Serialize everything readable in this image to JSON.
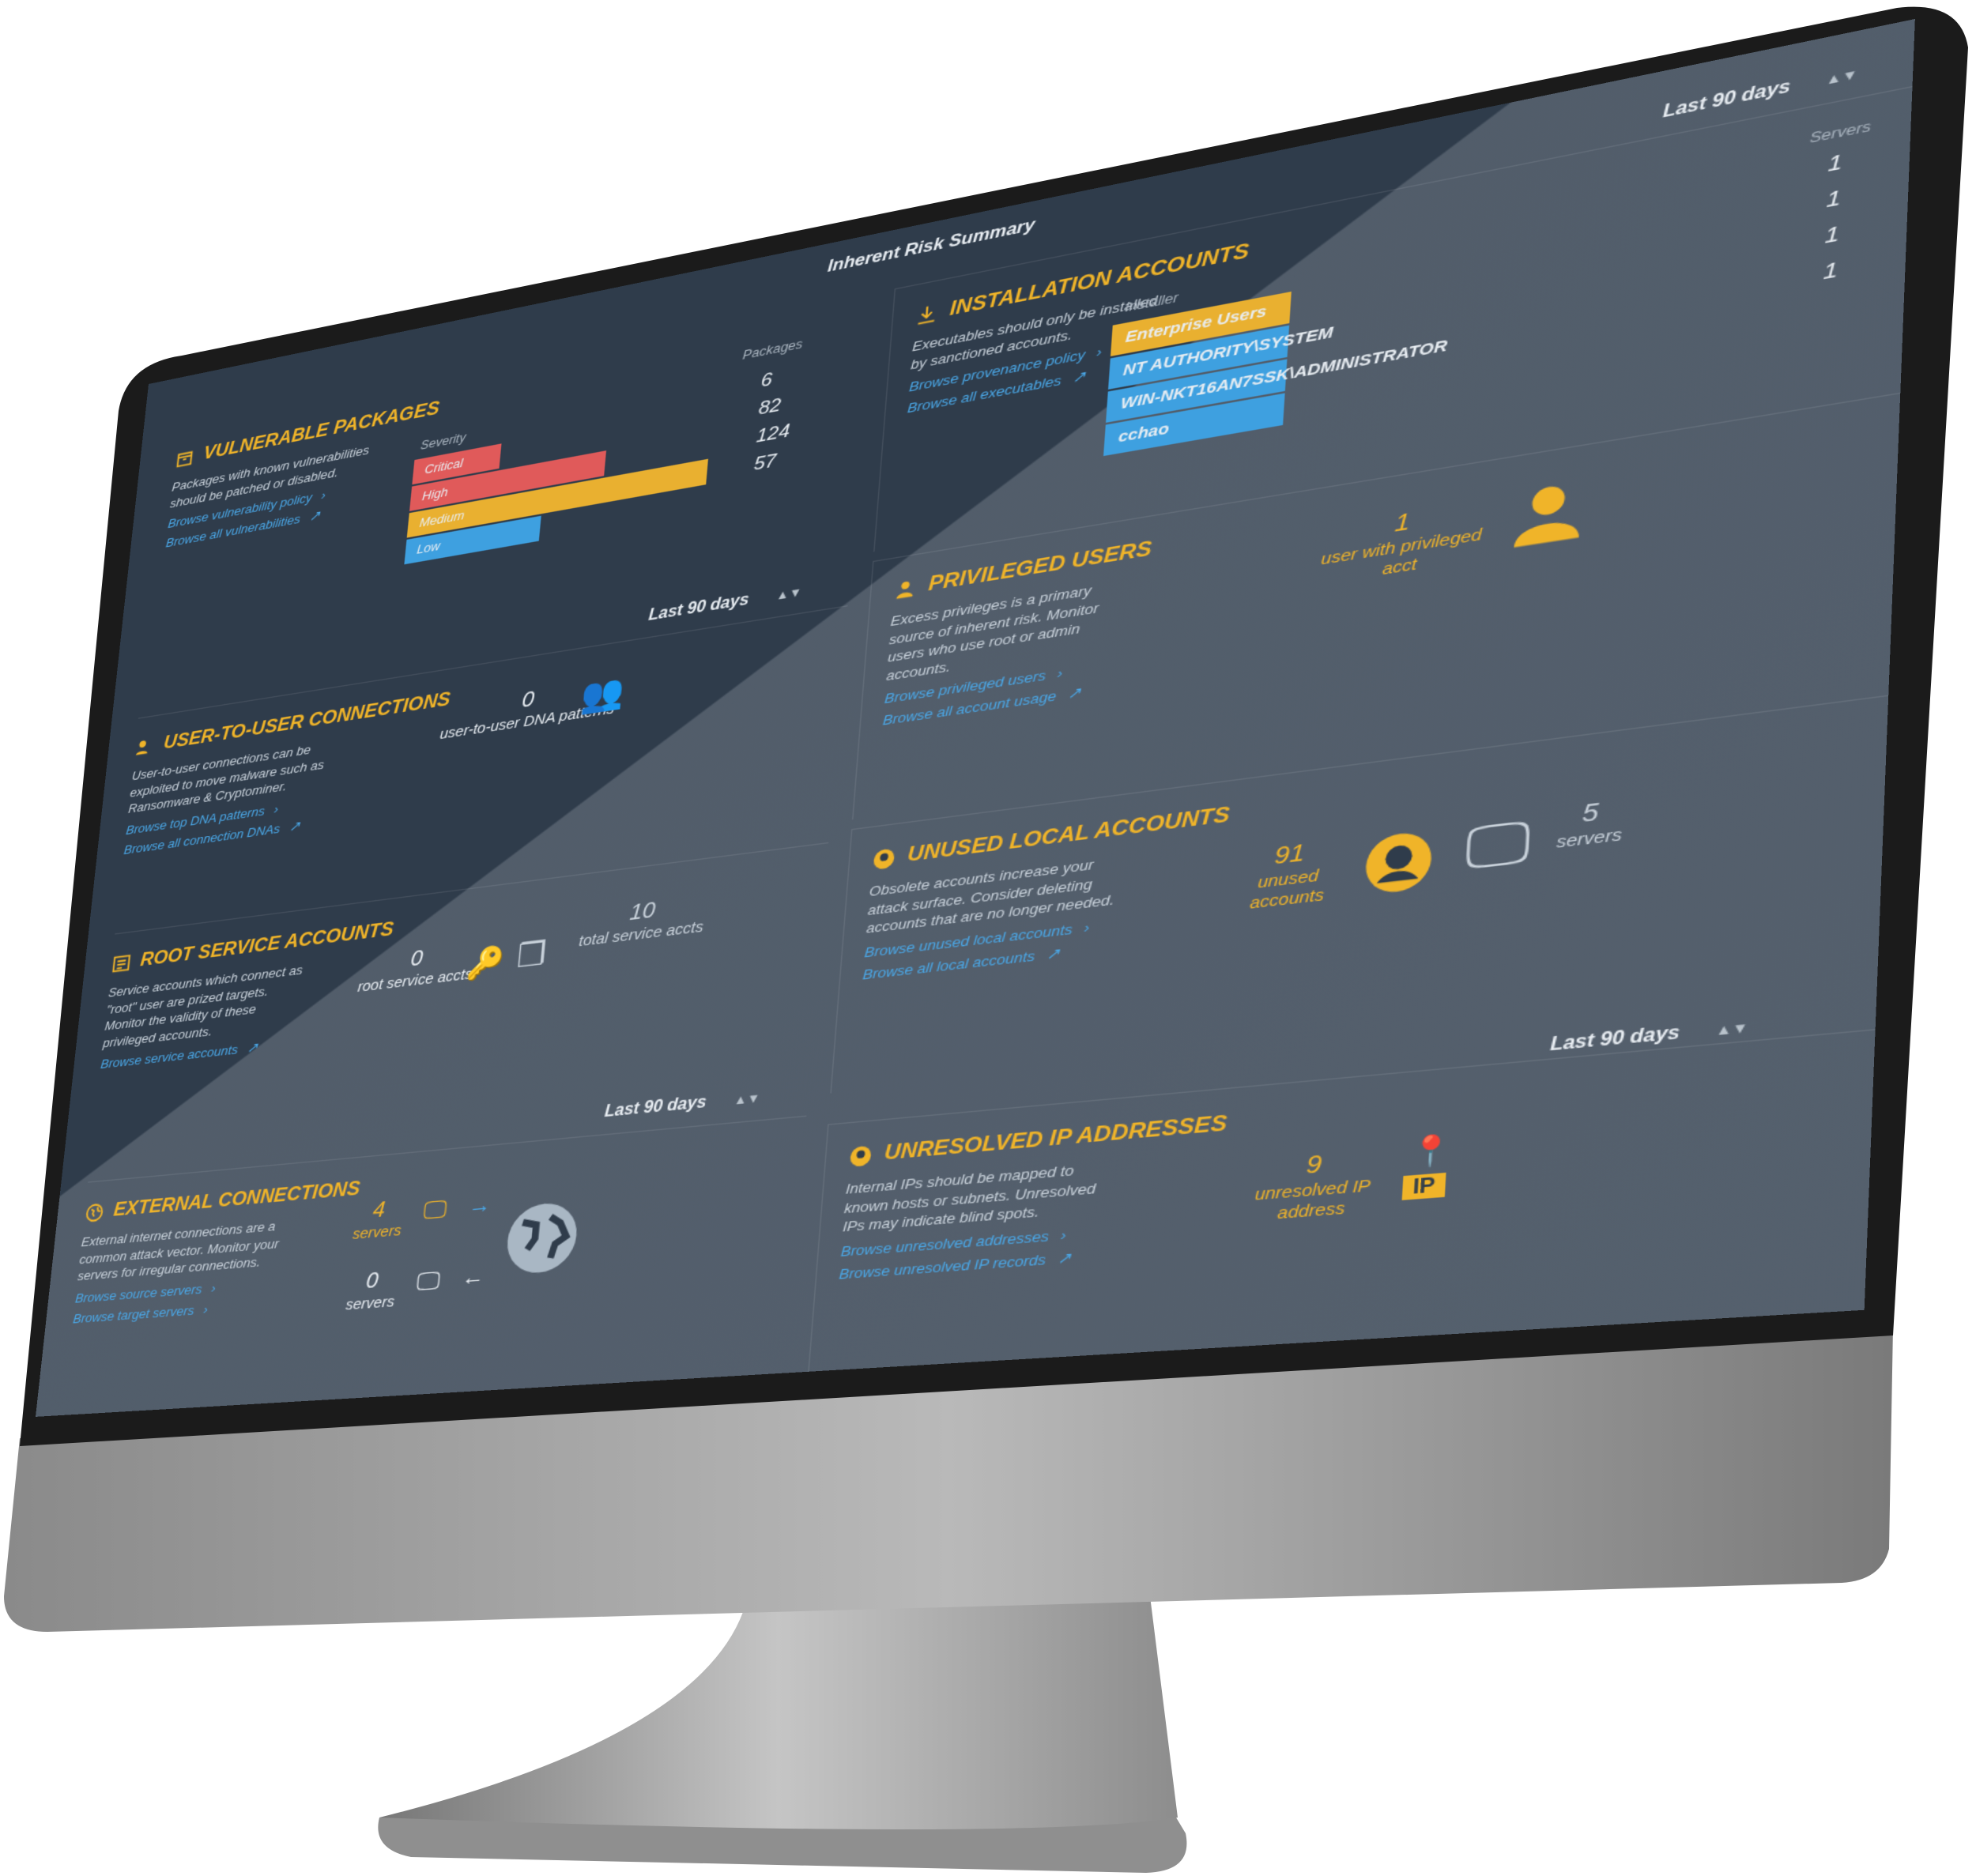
{
  "title": "Inherent Risk Summary",
  "colors": {
    "accent": "#f0b429",
    "link": "#4aa8e8",
    "critical": "#e05a5a",
    "high": "#e05a5a",
    "medium": "#e9b030",
    "low": "#3ea0e0",
    "bg_dark": "#2f3c4b"
  },
  "ranges": {
    "top": "Last 90 days",
    "mid_left": "Last 90 days",
    "bottom_left": "Last 90 days",
    "bottom_right": "Last 90 days"
  },
  "vulnerable": {
    "title": "VULNERABLE PACKAGES",
    "icon": "package-icon",
    "desc": "Packages with known vulnerabilities should be patched or disabled.",
    "link1": "Browse vulnerability policy",
    "link2": "Browse all vulnerabilities",
    "severity_header": "Severity",
    "packages_header": "Packages",
    "chart_data": {
      "type": "bar",
      "categories": [
        "Critical",
        "High",
        "Medium",
        "Low"
      ],
      "values": [
        6,
        82,
        124,
        57
      ],
      "xlabel": "Severity",
      "ylabel": "Packages"
    }
  },
  "u2u": {
    "title": "USER-TO-USER CONNECTIONS",
    "icon": "users-icon",
    "desc": "User-to-user connections can be exploited to move malware such as Ransomware & Cryptominer.",
    "link1": "Browse top DNA patterns",
    "link2": "Browse all connection DNAs",
    "count": "0",
    "label": "user-to-user DNA patterns"
  },
  "root": {
    "title": "ROOT SERVICE ACCOUNTS",
    "icon": "list-icon",
    "desc": "Service accounts which connect as \"root\" user are prized targets. Monitor the validity of these privileged accounts.",
    "link1": "Browse service accounts",
    "root_count": "0",
    "root_label": "root service accts",
    "total_count": "10",
    "total_label": "total service accts"
  },
  "external": {
    "title": "EXTERNAL CONNECTIONS",
    "icon": "globe-icon",
    "desc": "External internet connections are a common attack vector. Monitor your servers for irregular connections.",
    "link1": "Browse source servers",
    "link2": "Browse target servers",
    "out_count": "4",
    "out_label": "servers",
    "in_count": "0",
    "in_label": "servers"
  },
  "install": {
    "title": "INSTALLATION ACCOUNTS",
    "icon": "download-icon",
    "desc": "Executables should only be installed by sanctioned accounts.",
    "link1": "Browse provenance policy",
    "link2": "Browse all executables",
    "installer_header": "Installer",
    "servers_header": "Servers",
    "rows": [
      {
        "name": "Enterprise Users",
        "servers": "1"
      },
      {
        "name": "NT AUTHORITY\\SYSTEM",
        "servers": "1"
      },
      {
        "name": "WIN-NKT16AN7SSK\\ADMINISTRATOR",
        "servers": "1"
      },
      {
        "name": "cchao",
        "servers": "1"
      }
    ]
  },
  "privileged": {
    "title": "PRIVILEGED USERS",
    "icon": "user-icon",
    "desc": "Excess privileges is a primary source of inherent risk. Monitor users who use root or admin accounts.",
    "link1": "Browse privileged users",
    "link2": "Browse all account usage",
    "count": "1",
    "label": "user with privileged acct"
  },
  "unused": {
    "title": "UNUSED LOCAL ACCOUNTS",
    "icon": "user-circle-icon",
    "desc": "Obsolete accounts increase your attack surface. Consider deleting accounts that are no longer needed.",
    "link1": "Browse unused local accounts",
    "link2": "Browse all local accounts",
    "count": "91",
    "label": "unused accounts",
    "servers_count": "5",
    "servers_label": "servers"
  },
  "ip": {
    "title": "UNRESOLVED IP ADDRESSES",
    "icon": "user-circle-icon",
    "desc": "Internal IPs should be mapped to known hosts or subnets. Unresolved IPs may indicate blind spots.",
    "link1": "Browse unresolved addresses",
    "link2": "Browse unresolved IP records",
    "count": "9",
    "label": "unresolved IP address",
    "badge": "IP"
  }
}
